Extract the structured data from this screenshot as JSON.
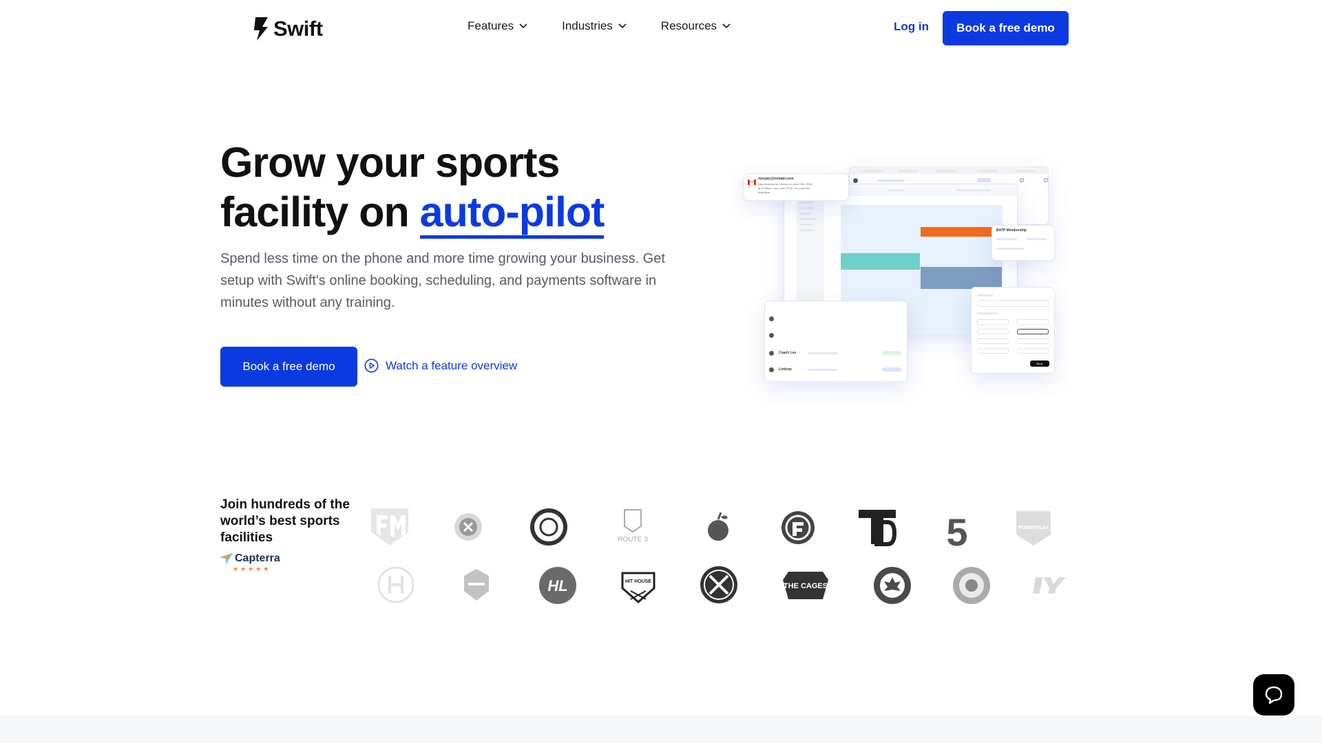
{
  "nav": {
    "brand": "Swift",
    "menu": [
      {
        "label": "Features"
      },
      {
        "label": "Industries"
      },
      {
        "label": "Resources"
      }
    ],
    "login_label": "Log in",
    "cta_label": "Book a free demo"
  },
  "hero": {
    "title_line1": "Grow your sports",
    "title_line2_prefix": "facility on ",
    "title_accent": "auto-pilot",
    "subtitle": "Spend less time on the phone and more time growing your business. Get setup with Swift's online booking, scheduling, and payments software in minutes without any training.",
    "cta_label": "Book a free demo",
    "watch_label": "Watch a feature overview"
  },
  "mock": {
    "email_from": "noreply@torbabl.com",
    "email_body1": "New Booking for Johnny on June 24th, 2024",
    "email_body2": "at 11:30pm. Use code \"8732\" to unlock the",
    "email_body3": "front door",
    "membership_title": "BATP Membership",
    "list_names": [
      "Coach Lee",
      "Lindsay"
    ],
    "book_label": "Book"
  },
  "proof": {
    "title": "Join hundreds of the world’s best sports facilities",
    "capterra_label": "Capterra",
    "logo_texts": [
      "THE CAGES",
      "HIT HOUSE",
      "HL",
      "ROUTE 3",
      "POWERPLAY",
      "5"
    ]
  },
  "colors": {
    "primary": "#0b3be0",
    "text": "#111111",
    "muted": "#555b66"
  }
}
